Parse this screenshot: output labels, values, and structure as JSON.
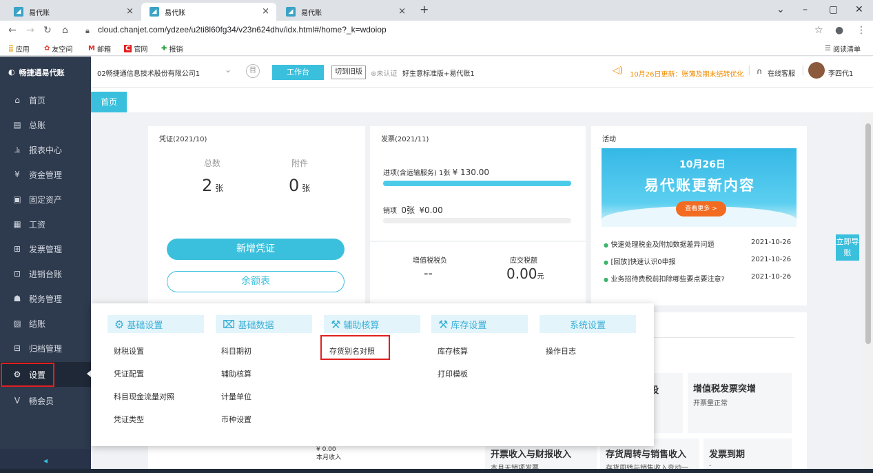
{
  "browser": {
    "tabs": [
      {
        "label": "易代账",
        "active": false
      },
      {
        "label": "易代账",
        "active": true
      },
      {
        "label": "易代账",
        "active": false
      }
    ],
    "new_tab": "+",
    "url": "cloud.chanjet.com/ydzee/u2ti8l60fg34/v23n624dhv/idx.html#/home?_k=wdoiop",
    "bookmarks": [
      "应用",
      "友空间",
      "邮箱",
      "官网",
      "报销"
    ],
    "reading_list": "阅读清单"
  },
  "header": {
    "logo": "畅捷通易代账",
    "company": "02畅捷通信息技术股份有限公司1",
    "workbench_btn": "工作台",
    "switch_old_btn": "切到旧版",
    "cert_status": "未认证",
    "edition": "好生意标准版+易代账1",
    "notice": "10月26日更新：账簿及期末结转优化",
    "online_service": "在线客服",
    "user": "李四代1"
  },
  "sidebar": {
    "items": [
      {
        "label": "首页",
        "icon": "home-icon"
      },
      {
        "label": "总账",
        "icon": "ledger-icon"
      },
      {
        "label": "报表中心",
        "icon": "chart-icon"
      },
      {
        "label": "资金管理",
        "icon": "money-icon"
      },
      {
        "label": "固定资产",
        "icon": "asset-icon"
      },
      {
        "label": "工资",
        "icon": "salary-icon"
      },
      {
        "label": "发票管理",
        "icon": "invoice-icon"
      },
      {
        "label": "进销台账",
        "icon": "stock-icon"
      },
      {
        "label": "税务管理",
        "icon": "tax-icon"
      },
      {
        "label": "结账",
        "icon": "close-icon"
      },
      {
        "label": "归档管理",
        "icon": "archive-icon"
      },
      {
        "label": "设置",
        "icon": "gear-icon"
      },
      {
        "label": "畅会员",
        "icon": "vip-icon"
      }
    ],
    "collapse_icon": "◂"
  },
  "main": {
    "home_tab": "首页",
    "voucher": {
      "title": "凭证(2021/10)",
      "total_label": "总数",
      "attach_label": "附件",
      "total_value": "2",
      "attach_value": "0",
      "unit": "张",
      "new_btn": "新增凭证",
      "balance_btn": "余额表"
    },
    "invoice": {
      "title": "发票(2021/11)",
      "in_label": "进项(含运输服务)",
      "in_count": "1张",
      "in_amount": "¥ 130.00",
      "in_progress": 1.0,
      "out_label": "销项",
      "out_count": "0张",
      "out_amount": "¥0.00",
      "out_progress": 0.0,
      "vat_label": "增值税税负",
      "vat_value": "--",
      "tax_label": "应交税额",
      "tax_value": "0.00",
      "tax_unit": "元"
    },
    "activity": {
      "title": "活动",
      "banner_date": "10月26日",
      "banner_title": "易代账更新内容",
      "banner_btn": "查看更多 >",
      "news": [
        {
          "text": "快速处理税金及附加数据差异问题",
          "date": "2021-10-26"
        },
        {
          "text": "[回放]快速认识0申报",
          "date": "2021-10-26"
        },
        {
          "text": "业务招待费税前扣除哪些要点要注意?",
          "date": "2021-10-26"
        }
      ]
    },
    "float_btn": "立即导账",
    "bottom": {
      "income_value": "¥ 0.00",
      "income_label": "本月收入",
      "card_vat_title": "增值税发票突增",
      "card_vat_sub": "开票量正常",
      "card_income_title": "开票收入与财报收入",
      "card_income_sub": "本月无销项发票",
      "card_stock_title": "存货周转与销售收入",
      "card_stock_sub": "存货周转与销售收入变动一",
      "card_due_title": "发票到期",
      "card_due_sub": "-"
    }
  },
  "popup": {
    "columns": [
      {
        "title": "基础设置",
        "icon": "settings-icon",
        "items": [
          "财税设置",
          "凭证配置",
          "科目现金流量对照",
          "凭证类型"
        ]
      },
      {
        "title": "基础数据",
        "icon": "data-icon",
        "items": [
          "科目期初",
          "辅助核算",
          "计量单位",
          "币种设置"
        ]
      },
      {
        "title": "辅助核算",
        "icon": "tool-icon",
        "items": [
          "存货别名对照"
        ]
      },
      {
        "title": "库存设置",
        "icon": "tool-icon",
        "items": [
          "库存核算",
          "打印模板"
        ]
      },
      {
        "title": "系统设置",
        "icon": "",
        "items": [
          "操作日志"
        ]
      }
    ]
  },
  "colors": {
    "accent": "#3ac0dd",
    "sidebar": "#2e3a4d",
    "highlight": "#e02020",
    "notice": "#f08c00"
  }
}
